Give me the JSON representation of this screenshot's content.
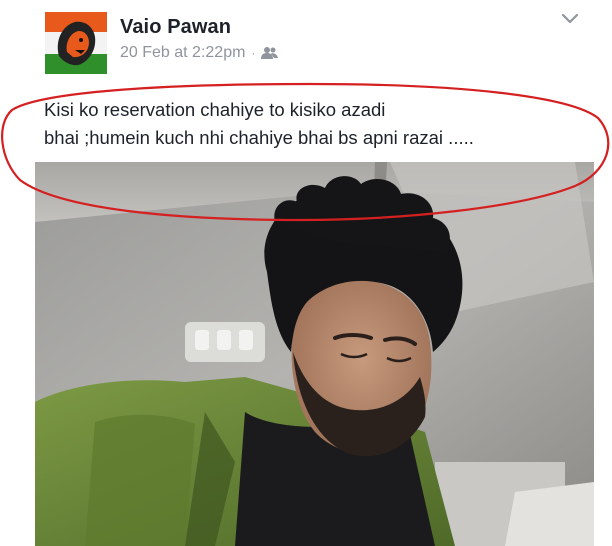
{
  "post": {
    "author": "Vaio Pawan",
    "timestamp": "20 Feb at 2:22pm",
    "separator": "·",
    "audience_icon": "friends-icon",
    "menu_icon": "chevron-down-icon",
    "caption_lines": [
      "Kisi ko reservation chahiye to kisiko azadi",
      "bhai ;humein kuch  nhi chahiye bhai bs apni razai ....."
    ]
  },
  "colors": {
    "name": "#1d2129",
    "meta": "#90949c",
    "annotation_circle": "#d42020",
    "avatar_orange": "#e85a1c",
    "avatar_green": "#2f8f2a",
    "jacket_green": "#6f8a3a"
  }
}
